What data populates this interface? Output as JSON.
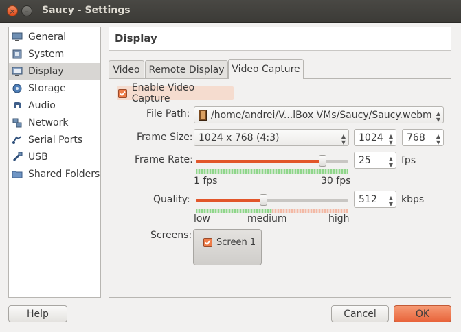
{
  "window": {
    "title": "Saucy - Settings",
    "close_glyph": "×",
    "minimize_glyph": "–"
  },
  "sidebar": {
    "items": [
      {
        "label": "General",
        "icon": "monitor-icon"
      },
      {
        "label": "System",
        "icon": "chip-icon"
      },
      {
        "label": "Display",
        "icon": "display-icon",
        "selected": true
      },
      {
        "label": "Storage",
        "icon": "storage-icon"
      },
      {
        "label": "Audio",
        "icon": "audio-icon"
      },
      {
        "label": "Network",
        "icon": "network-icon"
      },
      {
        "label": "Serial Ports",
        "icon": "serial-port-icon"
      },
      {
        "label": "USB",
        "icon": "usb-icon"
      },
      {
        "label": "Shared Folders",
        "icon": "folder-icon"
      }
    ]
  },
  "header": {
    "title": "Display"
  },
  "tabs": [
    {
      "label": "Video",
      "active": false
    },
    {
      "label": "Remote Display",
      "active": false
    },
    {
      "label": "Video Capture",
      "active": true
    }
  ],
  "capture": {
    "enable_label": "Enable Video Capture",
    "enabled": true,
    "file_path_label": "File Path:",
    "file_path_value": "/home/andrei/V...lBox VMs/Saucy/Saucy.webm",
    "frame_size_label": "Frame Size:",
    "frame_size_value": "1024 x 768 (4:3)",
    "frame_width": "1024",
    "frame_height": "768",
    "frame_rate_label": "Frame Rate:",
    "frame_rate_value": "25",
    "frame_rate_unit": "fps",
    "frame_rate_min_label": "1 fps",
    "frame_rate_max_label": "30 fps",
    "frame_rate_level": 0.83,
    "quality_label": "Quality:",
    "quality_value": "512",
    "quality_unit": "kbps",
    "quality_low": "low",
    "quality_medium": "medium",
    "quality_high": "high",
    "quality_level": 0.44,
    "screens_label": "Screens:",
    "screen1_label": "Screen 1",
    "screen1_checked": true
  },
  "buttons": {
    "help": "Help",
    "cancel": "Cancel",
    "ok": "OK"
  },
  "colors": {
    "accent": "#e8633a",
    "fill": "#e2562a",
    "tick_good": "#8fd68a",
    "tick_bad": "#f3b9a5"
  }
}
